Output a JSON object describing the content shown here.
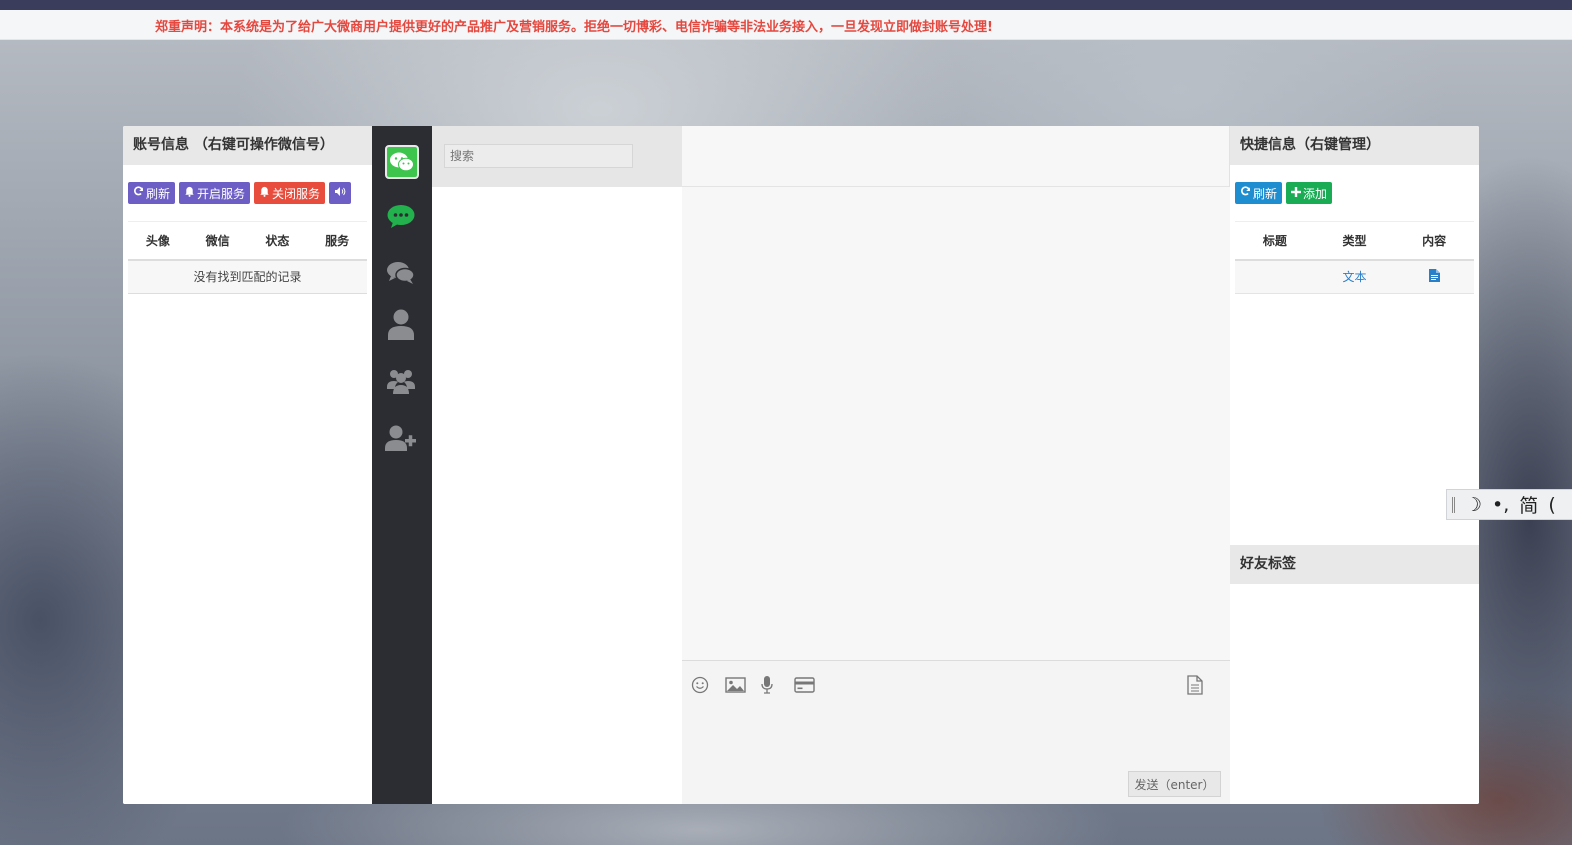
{
  "notice": "郑重声明：本系统是为了给广大微商用户提供更好的产品推广及营销服务。拒绝一切博彩、电信诈骗等非法业务接入，一旦发现立即做封账号处理!",
  "account_panel": {
    "title": "账号信息 （右键可操作微信号）",
    "buttons": {
      "refresh": "刷新",
      "start_service": "开启服务",
      "stop_service": "关闭服务"
    },
    "columns": [
      "头像",
      "微信",
      "状态",
      "服务"
    ],
    "empty_message": "没有找到匹配的记录"
  },
  "nav": {
    "icons": [
      "wechat-logo-icon",
      "chat-bubble-icon",
      "conversations-icon",
      "contact-icon",
      "group-icon",
      "add-friend-icon"
    ]
  },
  "contacts": {
    "search_placeholder": "搜索"
  },
  "chat": {
    "tools": [
      "emoji-icon",
      "image-icon",
      "microphone-icon",
      "card-icon",
      "document-icon"
    ],
    "send_label": "发送（enter）"
  },
  "quick_panel": {
    "title": "快捷信息（右键管理）",
    "buttons": {
      "refresh": "刷新",
      "add": "添加"
    },
    "columns": [
      "标题",
      "类型",
      "内容"
    ],
    "rows": [
      {
        "title": "",
        "type": "文本",
        "content_icon": "document-icon"
      }
    ]
  },
  "tags_panel": {
    "title": "好友标签"
  },
  "ime": {
    "mode": "简",
    "moon": "☽",
    "punct": "•,"
  },
  "colors": {
    "notice_text": "#e4483f",
    "purple_button": "#6d5ec6",
    "red_button": "#e84c3d",
    "blue_button": "#1f8ed0",
    "green_button": "#1aab55",
    "nav_bg": "#2b2d32",
    "wechat_green": "#3ec54e"
  }
}
